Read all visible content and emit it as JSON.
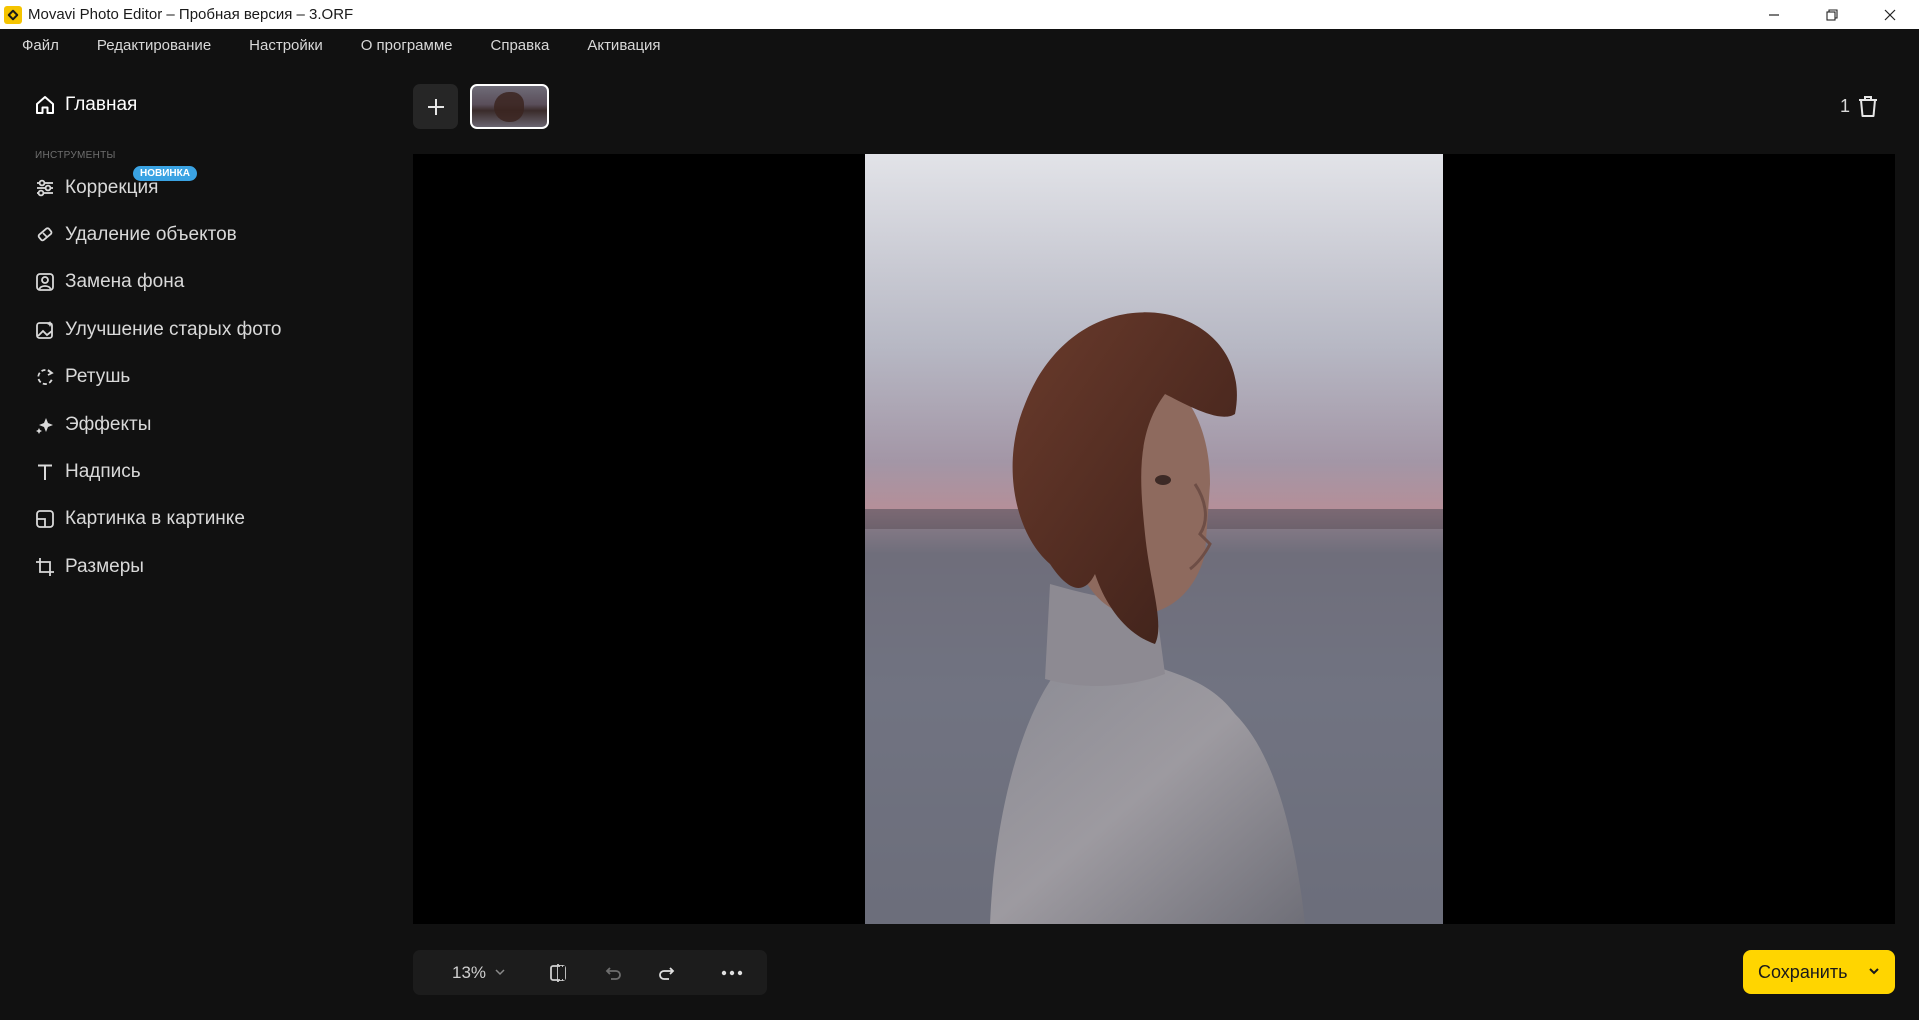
{
  "window": {
    "title": "Movavi Photo Editor – Пробная версия – 3.ORF",
    "controls": [
      "minimize-icon",
      "restore-icon",
      "close-icon"
    ]
  },
  "menu": [
    "Файл",
    "Редактирование",
    "Настройки",
    "О программе",
    "Справка",
    "Активация"
  ],
  "sidebar": {
    "home_label": "Главная",
    "section_label": "ИНСТРУМЕНТЫ",
    "badge": "НОВИНКА",
    "items": [
      {
        "label": "Коррекция",
        "icon": "sliders-icon"
      },
      {
        "label": "Удаление объектов",
        "icon": "eraser-icon"
      },
      {
        "label": "Замена фона",
        "icon": "portrait-icon"
      },
      {
        "label": "Улучшение старых фото",
        "icon": "photo-enhance-icon"
      },
      {
        "label": "Ретушь",
        "icon": "retouch-icon"
      },
      {
        "label": "Эффекты",
        "icon": "sparkle-icon"
      },
      {
        "label": "Надпись",
        "icon": "text-icon"
      },
      {
        "label": "Картинка в картинке",
        "icon": "picture-in-picture-icon"
      },
      {
        "label": "Размеры",
        "icon": "crop-icon"
      }
    ]
  },
  "strip": {
    "count": "1"
  },
  "toolbar": {
    "zoom": "13%"
  },
  "save": {
    "label": "Сохранить"
  },
  "colors": {
    "background": "#111111",
    "accent": "#ffd500",
    "badge": "#3aa3e3",
    "canvas": "#000000"
  }
}
